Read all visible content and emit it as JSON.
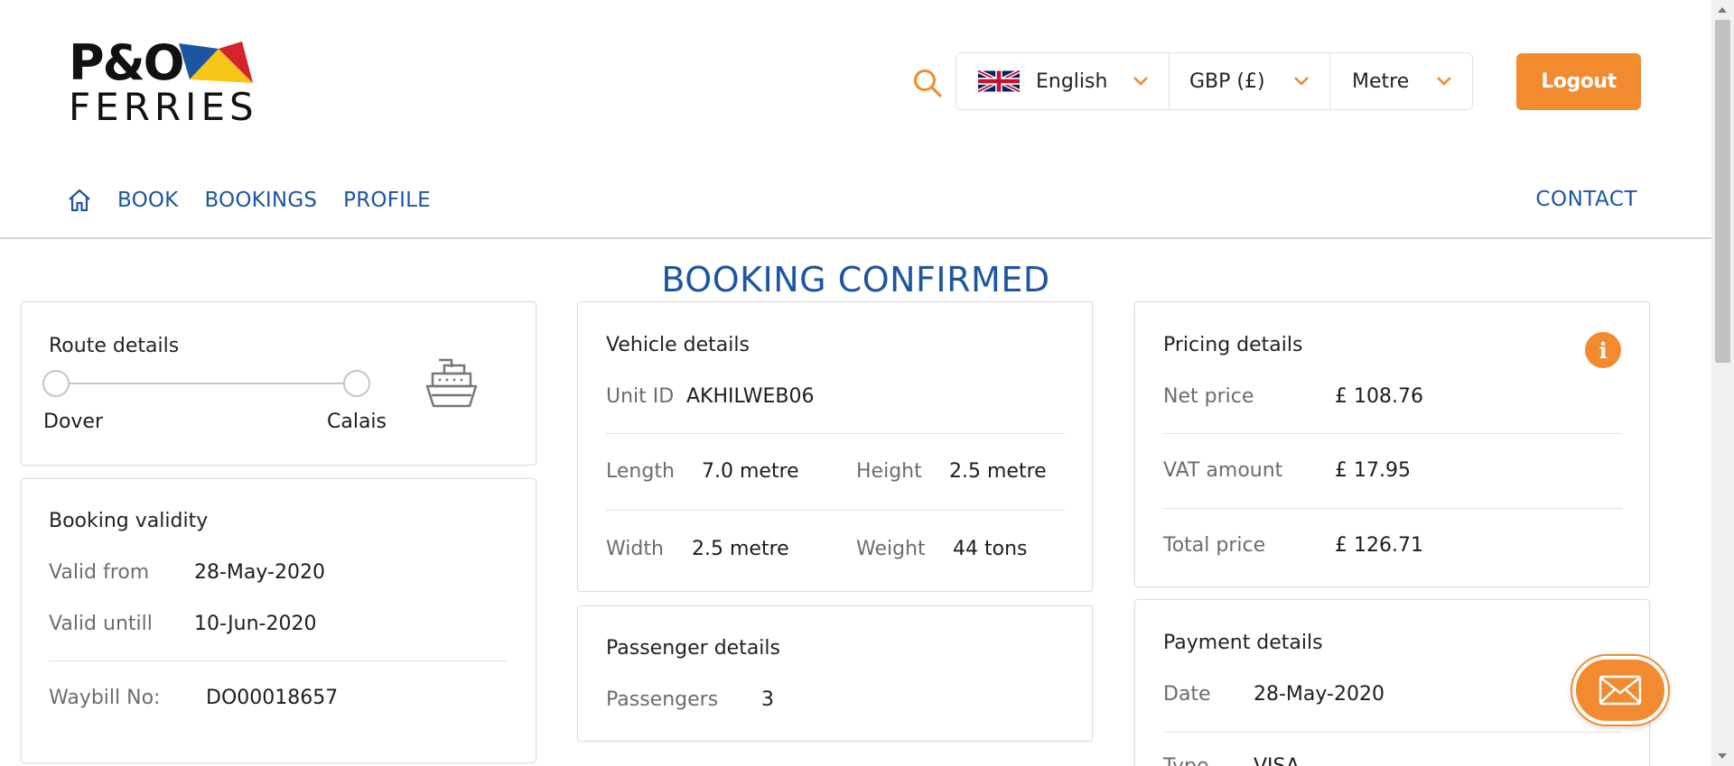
{
  "brand": {
    "logo_top": "P&O",
    "logo_bottom": "FERRIES"
  },
  "header": {
    "language": "English",
    "currency": "GBP (£)",
    "unit": "Metre",
    "logout_label": "Logout"
  },
  "nav": {
    "items": [
      {
        "label": "BOOK"
      },
      {
        "label": "BOOKINGS"
      },
      {
        "label": "PROFILE"
      }
    ],
    "contact": "CONTACT"
  },
  "page_title": "BOOKING CONFIRMED",
  "route": {
    "title": "Route details",
    "from": "Dover",
    "to": "Calais"
  },
  "validity": {
    "title": "Booking validity",
    "valid_from_label": "Valid from",
    "valid_from": "28-May-2020",
    "valid_until_label": "Valid untill",
    "valid_until": "10-Jun-2020",
    "waybill_label": "Waybill No:",
    "waybill": "DO00018657"
  },
  "vehicle": {
    "title": "Vehicle details",
    "unit_id_label": "Unit ID",
    "unit_id": "AKHILWEB06",
    "length_label": "Length",
    "length": "7.0 metre",
    "height_label": "Height",
    "height": "2.5 metre",
    "width_label": "Width",
    "width": "2.5 metre",
    "weight_label": "Weight",
    "weight": "44 tons"
  },
  "passengers": {
    "title": "Passenger details",
    "label": "Passengers",
    "count": "3"
  },
  "pricing": {
    "title": "Pricing details",
    "net_label": "Net price",
    "net": "£ 108.76",
    "vat_label": "VAT amount",
    "vat": "£ 17.95",
    "total_label": "Total price",
    "total": "£ 126.71"
  },
  "payment": {
    "title": "Payment details",
    "date_label": "Date",
    "date": "28-May-2020",
    "type_label": "Type",
    "type": "VISA"
  },
  "colors": {
    "accent": "#f28a30",
    "brand_blue": "#1d56a0"
  }
}
